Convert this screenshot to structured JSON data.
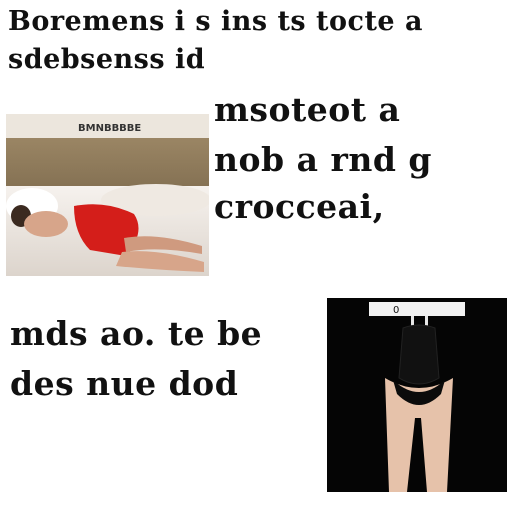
{
  "heading": {
    "line1": "Boremens i s ins ts tocte a",
    "line2": "sdebsenss id"
  },
  "middle_text": {
    "line1": "msoteot a",
    "line2": "nob a rnd g",
    "line3": "crocceai,"
  },
  "lower_text": {
    "line1": "mds ao. te be",
    "line2": "des nue dod"
  },
  "photo_top": {
    "caption": "BMNBBBBE",
    "wall_color": "#7c6a4e",
    "garment_color": "#d41e1a"
  },
  "photo_bottom": {
    "background_color": "#050505",
    "tag_text": "0"
  }
}
